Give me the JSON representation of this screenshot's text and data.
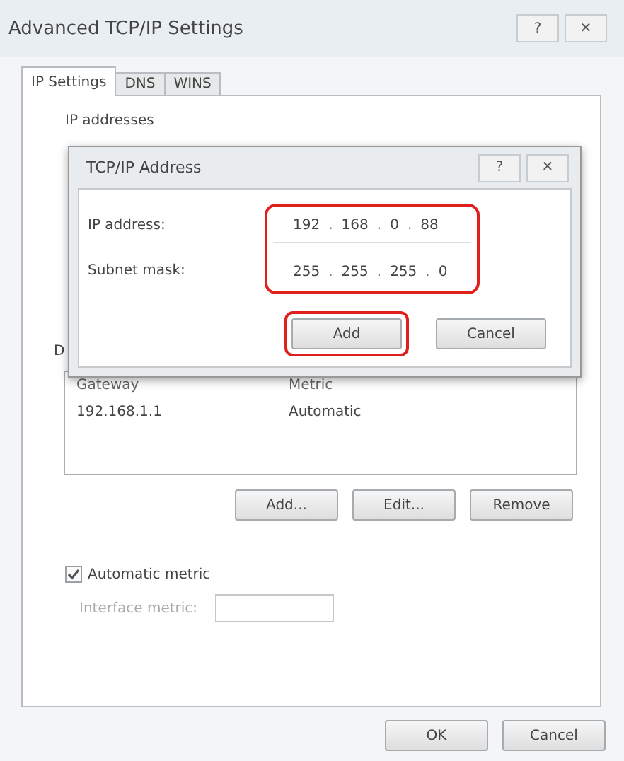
{
  "window": {
    "title": "Advanced TCP/IP Settings",
    "controls": [
      "?",
      "✕"
    ]
  },
  "tabs": [
    {
      "label": "IP Settings",
      "selected": true
    },
    {
      "label": "DNS",
      "selected": false
    },
    {
      "label": "WINS",
      "selected": false
    }
  ],
  "ip_addresses": {
    "label": "IP addresses"
  },
  "dialog": {
    "title": "TCP/IP Address",
    "controls": [
      "?",
      "✕"
    ],
    "fields_highlighted": true,
    "fields": [
      {
        "label": "IP address:",
        "octets": [
          "192",
          "168",
          "0",
          "88"
        ]
      },
      {
        "label": "Subnet mask:",
        "octets": [
          "255",
          "255",
          "255",
          "0"
        ]
      }
    ],
    "separator": ".",
    "buttons": [
      {
        "label": "Add",
        "highlighted": true
      },
      {
        "label": "Cancel",
        "highlighted": false
      }
    ]
  },
  "default_gateways": {
    "label": "D",
    "columns": [
      "Gateway",
      "Metric"
    ],
    "rows": [
      [
        "192.168.1.1",
        "Automatic"
      ]
    ],
    "buttons": [
      "Add...",
      "Edit...",
      "Remove"
    ]
  },
  "automatic_metric": {
    "label": "Automatic metric",
    "checked": true
  },
  "interface_metric": {
    "label": "Interface metric:",
    "disabled": true
  },
  "footer_buttons": [
    "OK",
    "Cancel"
  ]
}
